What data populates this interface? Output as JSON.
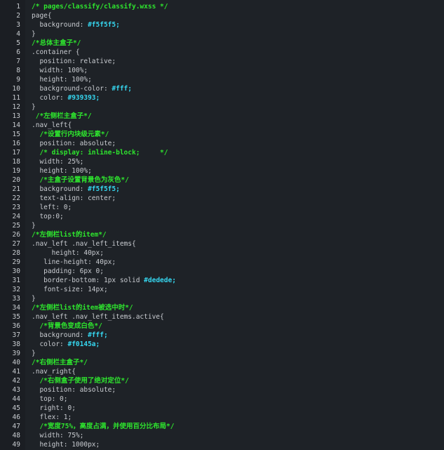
{
  "editor": {
    "file_comment": "/* pages/classify/classify.wxss */",
    "lines": [
      {
        "n": "1",
        "parts": [
          {
            "t": "/* pages/classify/classify.wxss */",
            "k": "comment"
          }
        ]
      },
      {
        "n": "2",
        "parts": [
          {
            "t": "page{",
            "k": "plain"
          }
        ]
      },
      {
        "n": "3",
        "parts": [
          {
            "t": "  background: ",
            "k": "plain"
          },
          {
            "t": "#f5f5f5;",
            "k": "color"
          }
        ]
      },
      {
        "n": "4",
        "parts": [
          {
            "t": "}",
            "k": "plain"
          }
        ]
      },
      {
        "n": "5",
        "parts": [
          {
            "t": "/*总体主盒子*/",
            "k": "comment"
          }
        ]
      },
      {
        "n": "6",
        "parts": [
          {
            "t": ".container {",
            "k": "plain"
          }
        ]
      },
      {
        "n": "7",
        "parts": [
          {
            "t": "  position: relative;",
            "k": "plain"
          }
        ]
      },
      {
        "n": "8",
        "parts": [
          {
            "t": "  width: 100%;",
            "k": "plain"
          }
        ]
      },
      {
        "n": "9",
        "parts": [
          {
            "t": "  height: 100%;",
            "k": "plain"
          }
        ]
      },
      {
        "n": "10",
        "parts": [
          {
            "t": "  background-color: ",
            "k": "plain"
          },
          {
            "t": "#fff;",
            "k": "color"
          }
        ]
      },
      {
        "n": "11",
        "parts": [
          {
            "t": "  color: ",
            "k": "plain"
          },
          {
            "t": "#939393;",
            "k": "color"
          }
        ]
      },
      {
        "n": "12",
        "parts": [
          {
            "t": "}",
            "k": "plain"
          }
        ]
      },
      {
        "n": "13",
        "parts": [
          {
            "t": " /*左侧栏主盒子*/",
            "k": "comment"
          }
        ]
      },
      {
        "n": "14",
        "parts": [
          {
            "t": ".nav_left{",
            "k": "plain"
          }
        ]
      },
      {
        "n": "15",
        "parts": [
          {
            "t": "  /*设置行内块级元素*/",
            "k": "comment"
          }
        ]
      },
      {
        "n": "16",
        "parts": [
          {
            "t": "  position: absolute;",
            "k": "plain"
          }
        ]
      },
      {
        "n": "17",
        "parts": [
          {
            "t": "  /* display: inline-block;     */",
            "k": "comment"
          }
        ]
      },
      {
        "n": "18",
        "parts": [
          {
            "t": "  width: 25%;",
            "k": "plain"
          }
        ]
      },
      {
        "n": "19",
        "parts": [
          {
            "t": "  height: 100%;",
            "k": "plain"
          }
        ]
      },
      {
        "n": "20",
        "parts": [
          {
            "t": "  /*主盒子设置背景色为灰色*/",
            "k": "comment"
          }
        ]
      },
      {
        "n": "21",
        "parts": [
          {
            "t": "  background: ",
            "k": "plain"
          },
          {
            "t": "#f5f5f5;",
            "k": "color"
          }
        ]
      },
      {
        "n": "22",
        "parts": [
          {
            "t": "  text-align: center;",
            "k": "plain"
          }
        ]
      },
      {
        "n": "23",
        "parts": [
          {
            "t": "  left: 0;",
            "k": "plain"
          }
        ]
      },
      {
        "n": "24",
        "parts": [
          {
            "t": "  top:0;",
            "k": "plain"
          }
        ]
      },
      {
        "n": "25",
        "parts": [
          {
            "t": "}",
            "k": "plain"
          }
        ]
      },
      {
        "n": "26",
        "parts": [
          {
            "t": "/*左侧栏list的item*/",
            "k": "comment"
          }
        ]
      },
      {
        "n": "27",
        "parts": [
          {
            "t": ".nav_left .nav_left_items{",
            "k": "plain"
          }
        ]
      },
      {
        "n": "28",
        "parts": [
          {
            "t": "     height: 40px;",
            "k": "plain"
          }
        ]
      },
      {
        "n": "29",
        "parts": [
          {
            "t": "   line-height: 40px;",
            "k": "plain"
          }
        ]
      },
      {
        "n": "30",
        "parts": [
          {
            "t": "   padding: 6px 0;",
            "k": "plain"
          }
        ]
      },
      {
        "n": "31",
        "parts": [
          {
            "t": "   border-bottom: 1px solid ",
            "k": "plain"
          },
          {
            "t": "#dedede;",
            "k": "color"
          }
        ]
      },
      {
        "n": "32",
        "parts": [
          {
            "t": "   font-size: 14px;",
            "k": "plain"
          }
        ]
      },
      {
        "n": "33",
        "parts": [
          {
            "t": "}",
            "k": "plain"
          }
        ]
      },
      {
        "n": "34",
        "parts": [
          {
            "t": "/*左侧栏list的item被选中时*/",
            "k": "comment"
          }
        ]
      },
      {
        "n": "35",
        "parts": [
          {
            "t": ".nav_left .nav_left_items.active{",
            "k": "plain"
          }
        ]
      },
      {
        "n": "36",
        "parts": [
          {
            "t": "  /*背景色变成白色*/",
            "k": "comment"
          }
        ]
      },
      {
        "n": "37",
        "parts": [
          {
            "t": "  background: ",
            "k": "plain"
          },
          {
            "t": "#fff;",
            "k": "color"
          }
        ]
      },
      {
        "n": "38",
        "parts": [
          {
            "t": "  color: ",
            "k": "plain"
          },
          {
            "t": "#f0145a;",
            "k": "color"
          }
        ]
      },
      {
        "n": "39",
        "parts": [
          {
            "t": "}",
            "k": "plain"
          }
        ]
      },
      {
        "n": "40",
        "parts": [
          {
            "t": "/*右侧栏主盒子*/",
            "k": "comment"
          }
        ]
      },
      {
        "n": "41",
        "parts": [
          {
            "t": ".nav_right{",
            "k": "plain"
          }
        ]
      },
      {
        "n": "42",
        "parts": [
          {
            "t": "  /*右侧盒子使用了绝对定位*/",
            "k": "comment"
          }
        ]
      },
      {
        "n": "43",
        "parts": [
          {
            "t": "  position: absolute;",
            "k": "plain"
          }
        ]
      },
      {
        "n": "44",
        "parts": [
          {
            "t": "  top: 0;",
            "k": "plain"
          }
        ]
      },
      {
        "n": "45",
        "parts": [
          {
            "t": "  right: 0;",
            "k": "plain"
          }
        ]
      },
      {
        "n": "46",
        "parts": [
          {
            "t": "  flex: 1;",
            "k": "plain"
          }
        ]
      },
      {
        "n": "47",
        "parts": [
          {
            "t": "  /*宽度75%，高度占满，并使用百分比布局*/",
            "k": "comment"
          }
        ]
      },
      {
        "n": "48",
        "parts": [
          {
            "t": "  width: 75%;",
            "k": "plain"
          }
        ]
      },
      {
        "n": "49",
        "parts": [
          {
            "t": "  height: 1000px;",
            "k": "plain"
          }
        ]
      }
    ],
    "colors": {
      "background": "#1e2227",
      "gutter": "#1b1e23",
      "line_number": "#c8ccd0",
      "plain": "#c9ccd1",
      "comment": "#2ee52e",
      "color_literal": "#36d7f0"
    }
  }
}
